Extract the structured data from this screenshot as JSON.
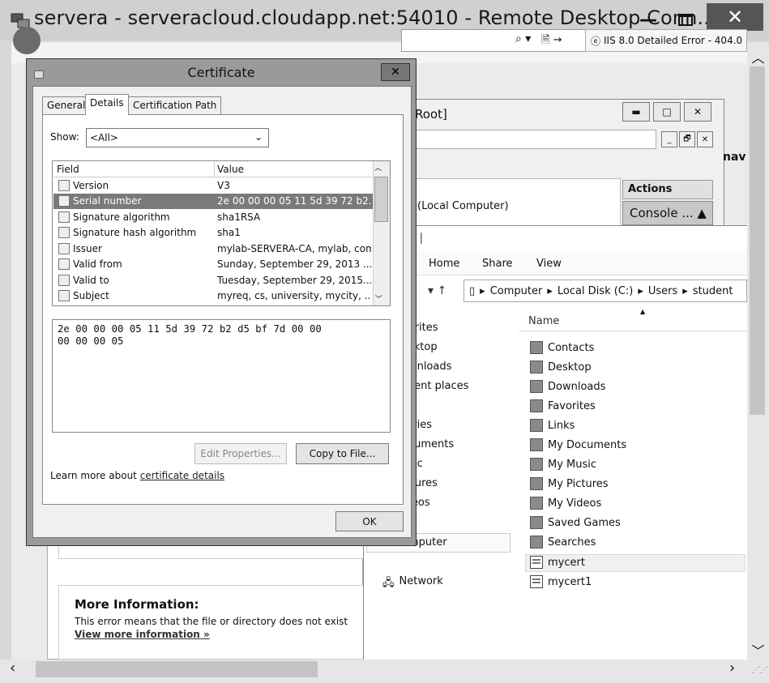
{
  "rdp": {
    "title": "servera - serveracloud.cloudapp.net:54010 - Remote Desktop Conn...",
    "minimize_glyph": "—",
    "close_glyph": "✕"
  },
  "browser": {
    "tab_title": "IIS 8.0 Detailed Error - 404.0",
    "search_glyph": "⌕ ▾",
    "compat_glyph": "🗎 →",
    "info_title": "More Information:",
    "info_text": "This error means that the file or directory does not exist",
    "info_link": "View more information »"
  },
  "mmc": {
    "title_fragment": "Root]",
    "local_computer": "(Local Computer)",
    "actions_header": "Actions",
    "console_item": "Console ... ▲",
    "nav_fragment": "nav",
    "btn_min": "▬",
    "btn_max": "□",
    "btn_close": "✕",
    "inner_min": "_",
    "inner_restore": "🗗",
    "inner_close": "✕"
  },
  "explorer": {
    "qat": "▾ |",
    "ribbon_tabs": [
      "Home",
      "Share",
      "View"
    ],
    "nav_arrows": "▾  ↑",
    "path": [
      "Computer",
      "Local Disk (C:)",
      "Users",
      "student"
    ],
    "column_name": "Name",
    "nav_pane": [
      "vorites",
      "esktop",
      "ownloads",
      "ecent places",
      "raries",
      "ocuments",
      "usic",
      "ictures",
      "ideos",
      "omputer",
      "Network"
    ],
    "files": [
      "Contacts",
      "Desktop",
      "Downloads",
      "Favorites",
      "Links",
      "My Documents",
      "My Music",
      "My Pictures",
      "My Videos",
      "Saved Games",
      "Searches",
      "mycert",
      "mycert1"
    ]
  },
  "certificate": {
    "title": "Certificate",
    "close_glyph": "✕",
    "tabs": [
      "General",
      "Details",
      "Certification Path"
    ],
    "show_label": "Show:",
    "show_value": "<All>",
    "columns": {
      "field": "Field",
      "value": "Value"
    },
    "rows": [
      {
        "field": "Version",
        "value": "V3"
      },
      {
        "field": "Serial number",
        "value": "2e 00 00 00 05 11 5d 39 72 b2..."
      },
      {
        "field": "Signature algorithm",
        "value": "sha1RSA"
      },
      {
        "field": "Signature hash algorithm",
        "value": "sha1"
      },
      {
        "field": "Issuer",
        "value": "mylab-SERVERA-CA, mylab, com"
      },
      {
        "field": "Valid from",
        "value": "Sunday, September 29, 2013 ..."
      },
      {
        "field": "Valid to",
        "value": "Tuesday, September 29, 2015..."
      },
      {
        "field": "Subject",
        "value": "myreq, cs, university, mycity, ..."
      }
    ],
    "selected_row": "Serial number",
    "hex_value": "2e 00 00 00 05 11 5d 39 72 b2 d5 bf 7d 00 00\n00 00 00 05",
    "edit_properties": "Edit Properties...",
    "copy_to_file": "Copy to File...",
    "learn_prefix": "Learn more about ",
    "learn_link": "certificate details",
    "ok": "OK"
  }
}
